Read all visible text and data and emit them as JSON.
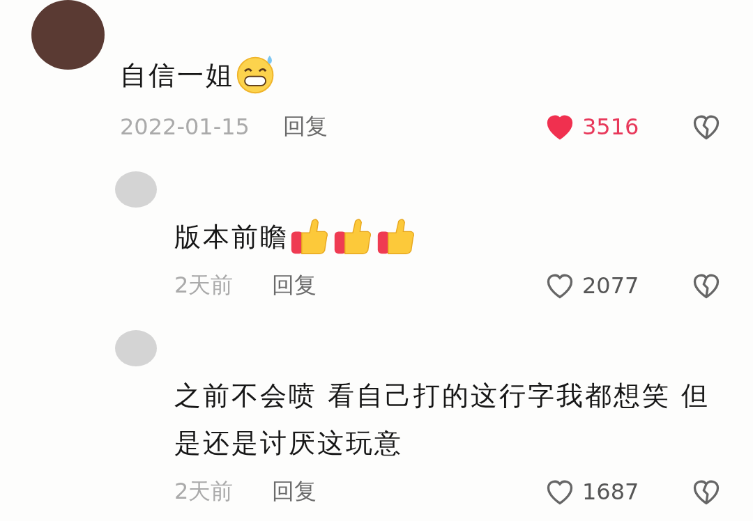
{
  "comments": [
    {
      "text": "自信一姐",
      "emojis": [
        {
          "kind": "grin-sweat"
        }
      ],
      "time": "2022-01-15",
      "reply": "回复",
      "likes": "3516",
      "liked": true,
      "children": [
        {
          "text": "版本前瞻",
          "emojis": [
            {
              "kind": "thumbs-up"
            },
            {
              "kind": "thumbs-up"
            },
            {
              "kind": "thumbs-up"
            }
          ],
          "time": "2天前",
          "reply": "回复",
          "likes": "2077",
          "liked": false
        },
        {
          "text": "之前不会喷 看自己打的这行字我都想笑 但是还是讨厌这玩意",
          "time": "2天前",
          "reply": "回复",
          "likes": "1687",
          "liked": false
        }
      ]
    }
  ]
}
